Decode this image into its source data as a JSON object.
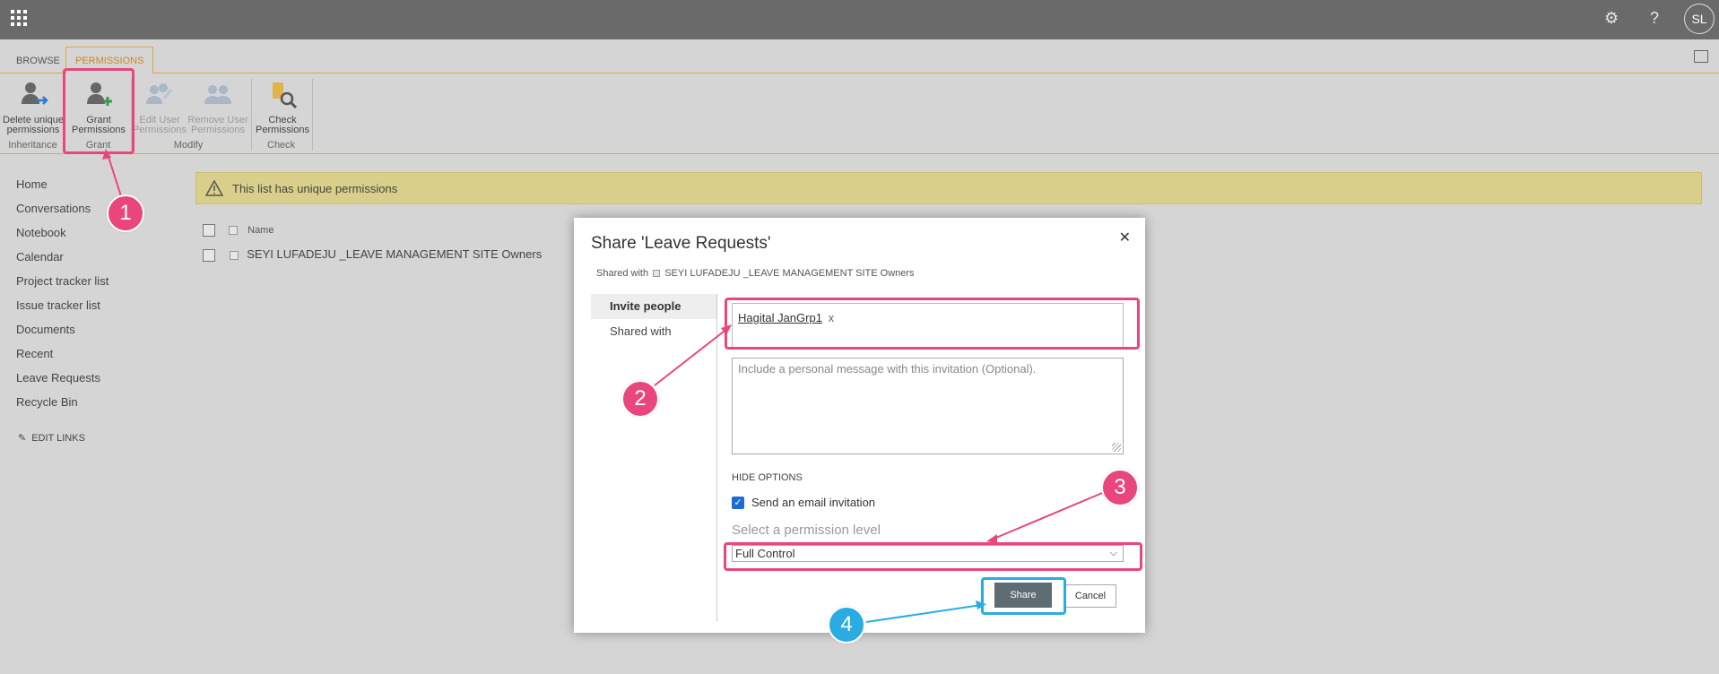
{
  "suite": {
    "avatar_initials": "SL",
    "help_glyph": "?",
    "settings_glyph": "⚙"
  },
  "tabs": [
    "BROWSE",
    "PERMISSIONS"
  ],
  "ribbon": {
    "commands": {
      "delete_unique": "Delete unique permissions",
      "grant": "Grant Permissions",
      "edit_user": "Edit User Permissions",
      "remove_user": "Remove User Permissions",
      "check": "Check Permissions"
    },
    "groups": {
      "inheritance": "Inheritance",
      "grant": "Grant",
      "modify": "Modify",
      "check": "Check"
    }
  },
  "nav": {
    "items": [
      "Home",
      "Conversations",
      "Notebook",
      "Calendar",
      "Project tracker list",
      "Issue tracker list",
      "Documents",
      "Recent",
      "Leave Requests",
      "Recycle Bin"
    ],
    "edit_links": "EDIT LINKS"
  },
  "warning": "This list has unique permissions",
  "list": {
    "column_name": "Name",
    "row": "SEYI LUFADEJU _LEAVE MANAGEMENT SITE Owners"
  },
  "dialog": {
    "title": "Share 'Leave Requests'",
    "close": "✕",
    "shared_with_label": "Shared with",
    "shared_with_value": "SEYI LUFADEJU _LEAVE MANAGEMENT SITE Owners",
    "side": [
      "Invite people",
      "Shared with"
    ],
    "invitee": "Hagital JanGrp1",
    "invitee_remove": "x",
    "message_placeholder": "Include a personal message with this invitation (Optional).",
    "hide_options": "HIDE OPTIONS",
    "email_invitation": "Send an email invitation",
    "permission_label": "Select a permission level",
    "permission_value": "Full Control",
    "share": "Share",
    "cancel": "Cancel"
  },
  "annotations": [
    "1",
    "2",
    "3",
    "4"
  ],
  "colors": {
    "highlight": "#e8467c",
    "highlight_blue": "#2aace2",
    "accent": "#e0a93a"
  }
}
